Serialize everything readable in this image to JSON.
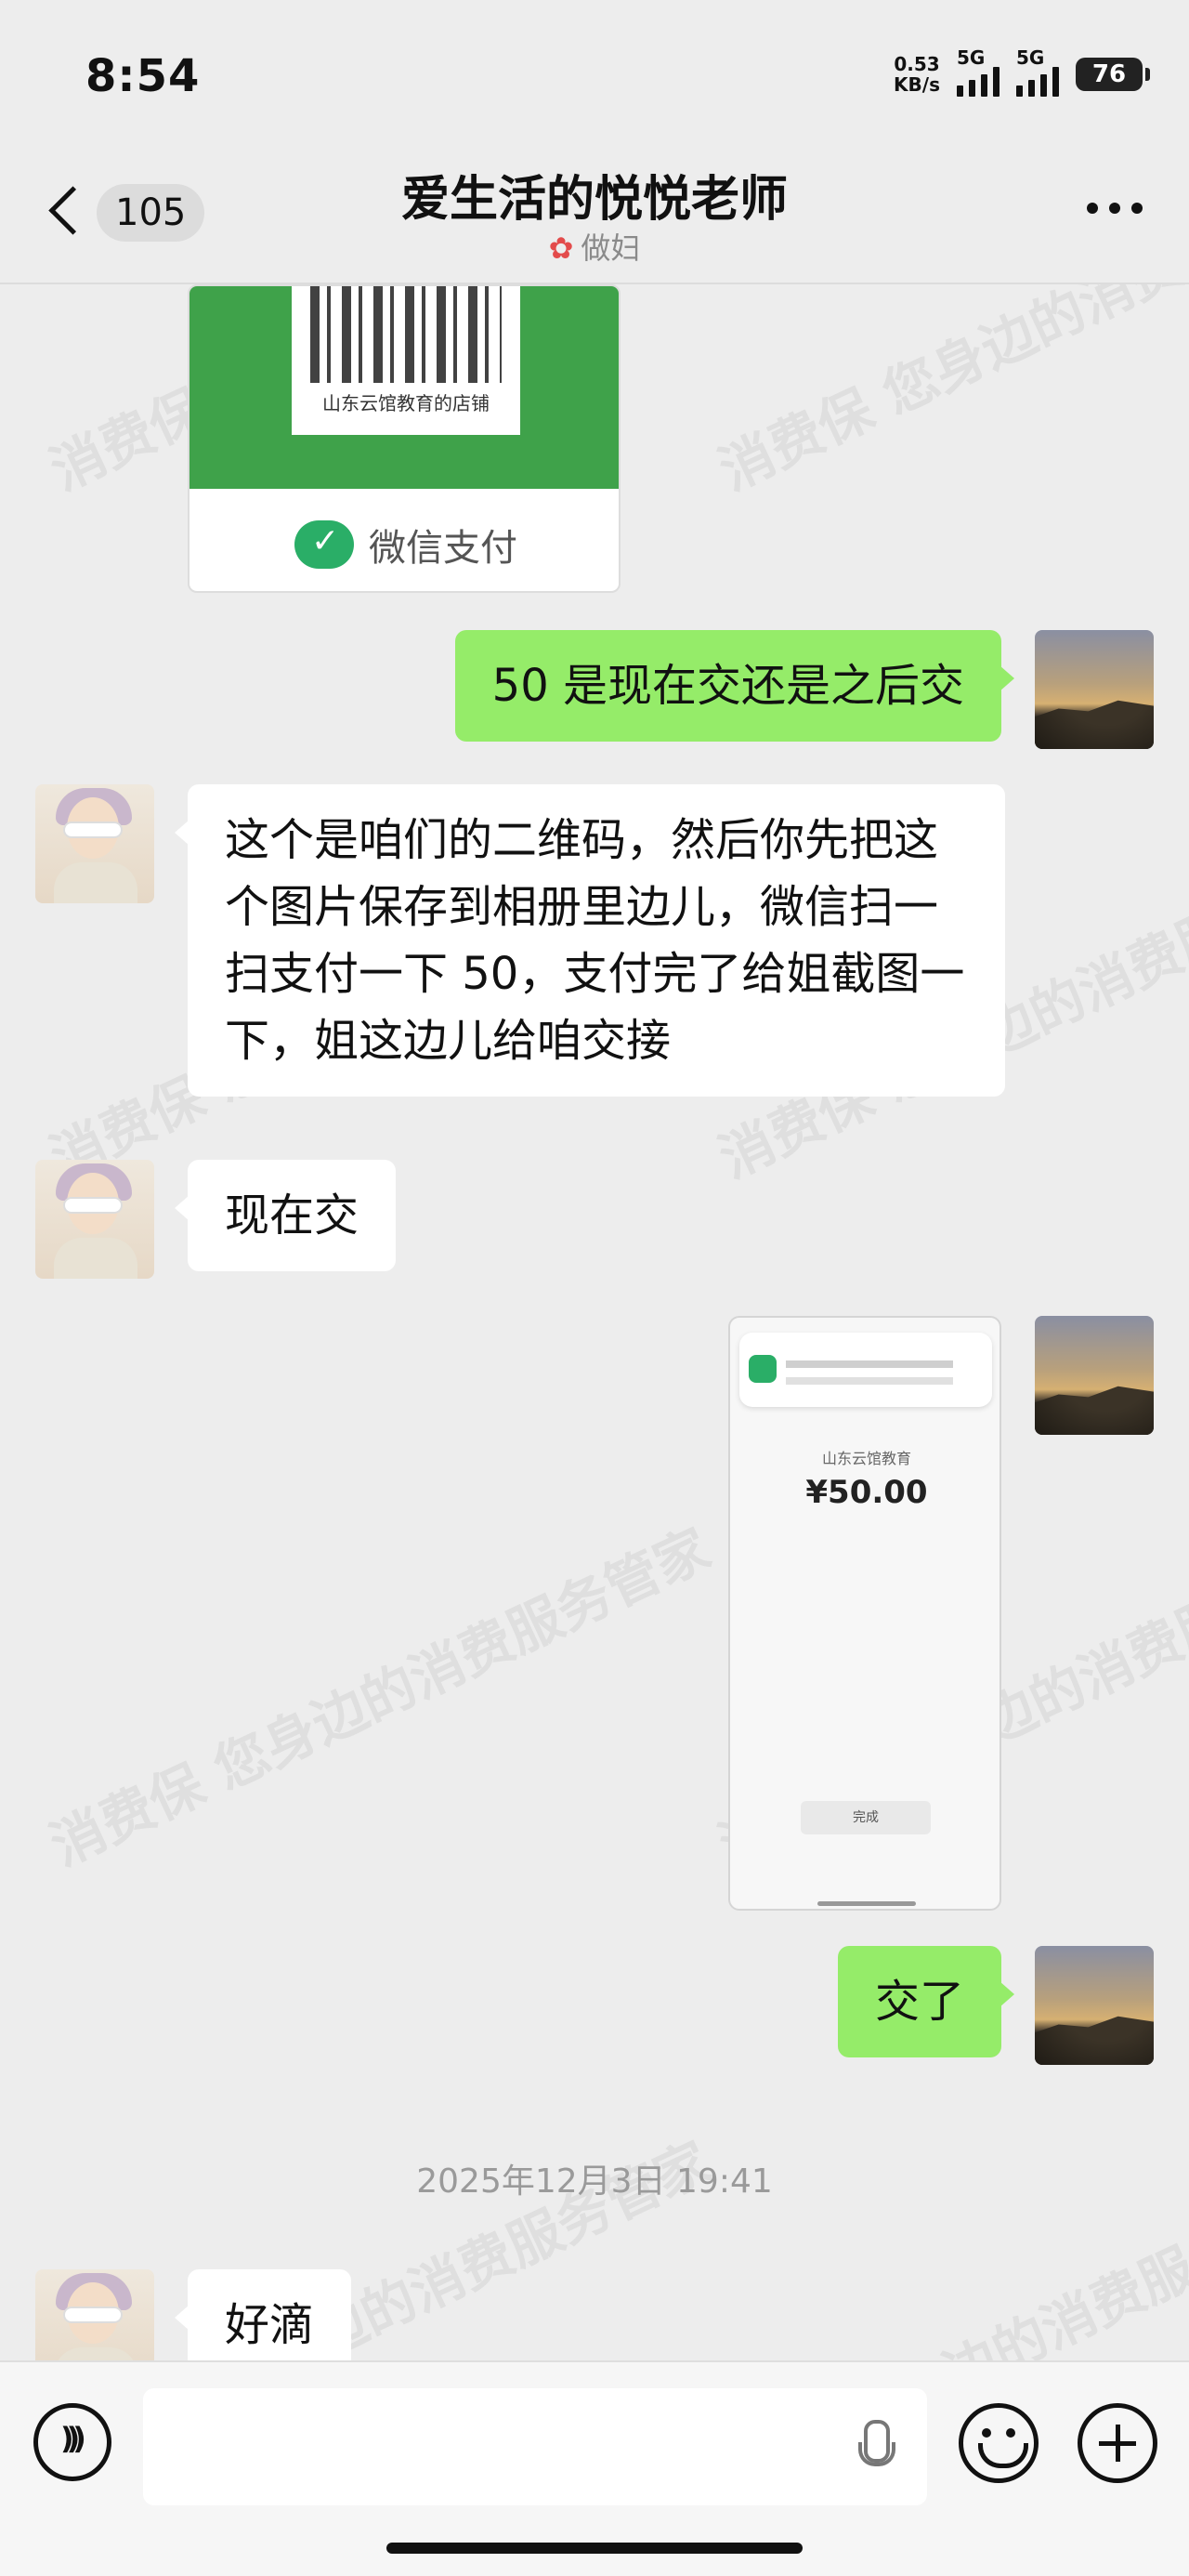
{
  "status_bar": {
    "time": "8:54",
    "net_speed_value": "0.53",
    "net_speed_unit": "KB/s",
    "signal_1": "5G",
    "signal_2": "5G",
    "battery": "76"
  },
  "header": {
    "back_count": "105",
    "title": "爱生活的悦悦老师",
    "subtitle": "做妇"
  },
  "images": {
    "qr_shop_name": "山东云馆教育的店铺",
    "qr_caption": "微信支付",
    "payment_shop": "山东云馆教育",
    "payment_amount": "¥50.00",
    "payment_done": "完成"
  },
  "messages": [
    {
      "sender": "self",
      "text": "50 是现在交还是之后交"
    },
    {
      "sender": "other",
      "text": "这个是咱们的二维码，然后你先把这个图片保存到相册里边儿，微信扫一扫支付一下 50，支付完了给姐截图一下，姐这边儿给咱交接"
    },
    {
      "sender": "other",
      "text": "现在交"
    },
    {
      "sender": "self",
      "text": "交了"
    },
    {
      "sender": "other",
      "text": "好滴"
    }
  ],
  "timestamp": "2025年12月3日 19:41",
  "watermark": "消费保 您身边的消费服务管家",
  "input": {
    "placeholder": ""
  }
}
